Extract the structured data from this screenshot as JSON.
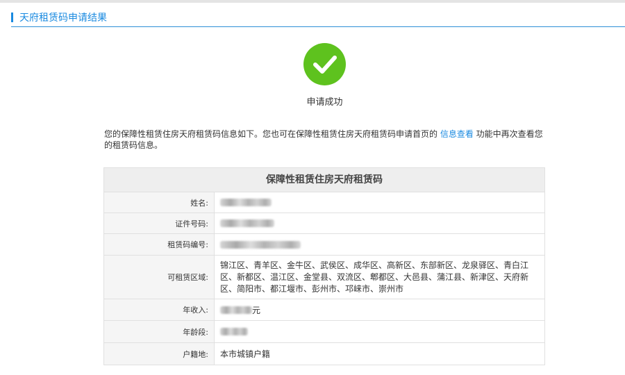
{
  "header": {
    "title": "天府租赁码申请结果"
  },
  "status": {
    "icon": "check-circle-icon",
    "text": "申请成功",
    "color": "#5ec21e"
  },
  "info": {
    "before": "您的保障性租赁住房天府租赁码信息如下。您也可在保障性租赁住房天府租赁码申请首页的 ",
    "link": "信息查看",
    "after": " 功能中再次查看您的租赁码信息。"
  },
  "card": {
    "title": "保障性租赁住房天府租赁码",
    "fields": {
      "name": {
        "label": "姓名:"
      },
      "id_number": {
        "label": "证件号码:"
      },
      "code_number": {
        "label": "租赁码编号:"
      },
      "areas": {
        "label": "可租赁区域:",
        "value": "锦江区、青羊区、金牛区、武侯区、成华区、高新区、东部新区、龙泉驿区、青白江区、新都区、温江区、金堂县、双流区、郫都区、大邑县、蒲江县、新津区、天府新区、简阳市、都江堰市、彭州市、邛崃市、崇州市"
      },
      "income": {
        "label": "年收入:",
        "suffix": "元"
      },
      "age_range": {
        "label": "年龄段:"
      },
      "household": {
        "label": "户籍地:",
        "value": "本市城镇户籍"
      }
    }
  },
  "colors": {
    "accent": "#1a8ae0",
    "success": "#5ec21e"
  }
}
